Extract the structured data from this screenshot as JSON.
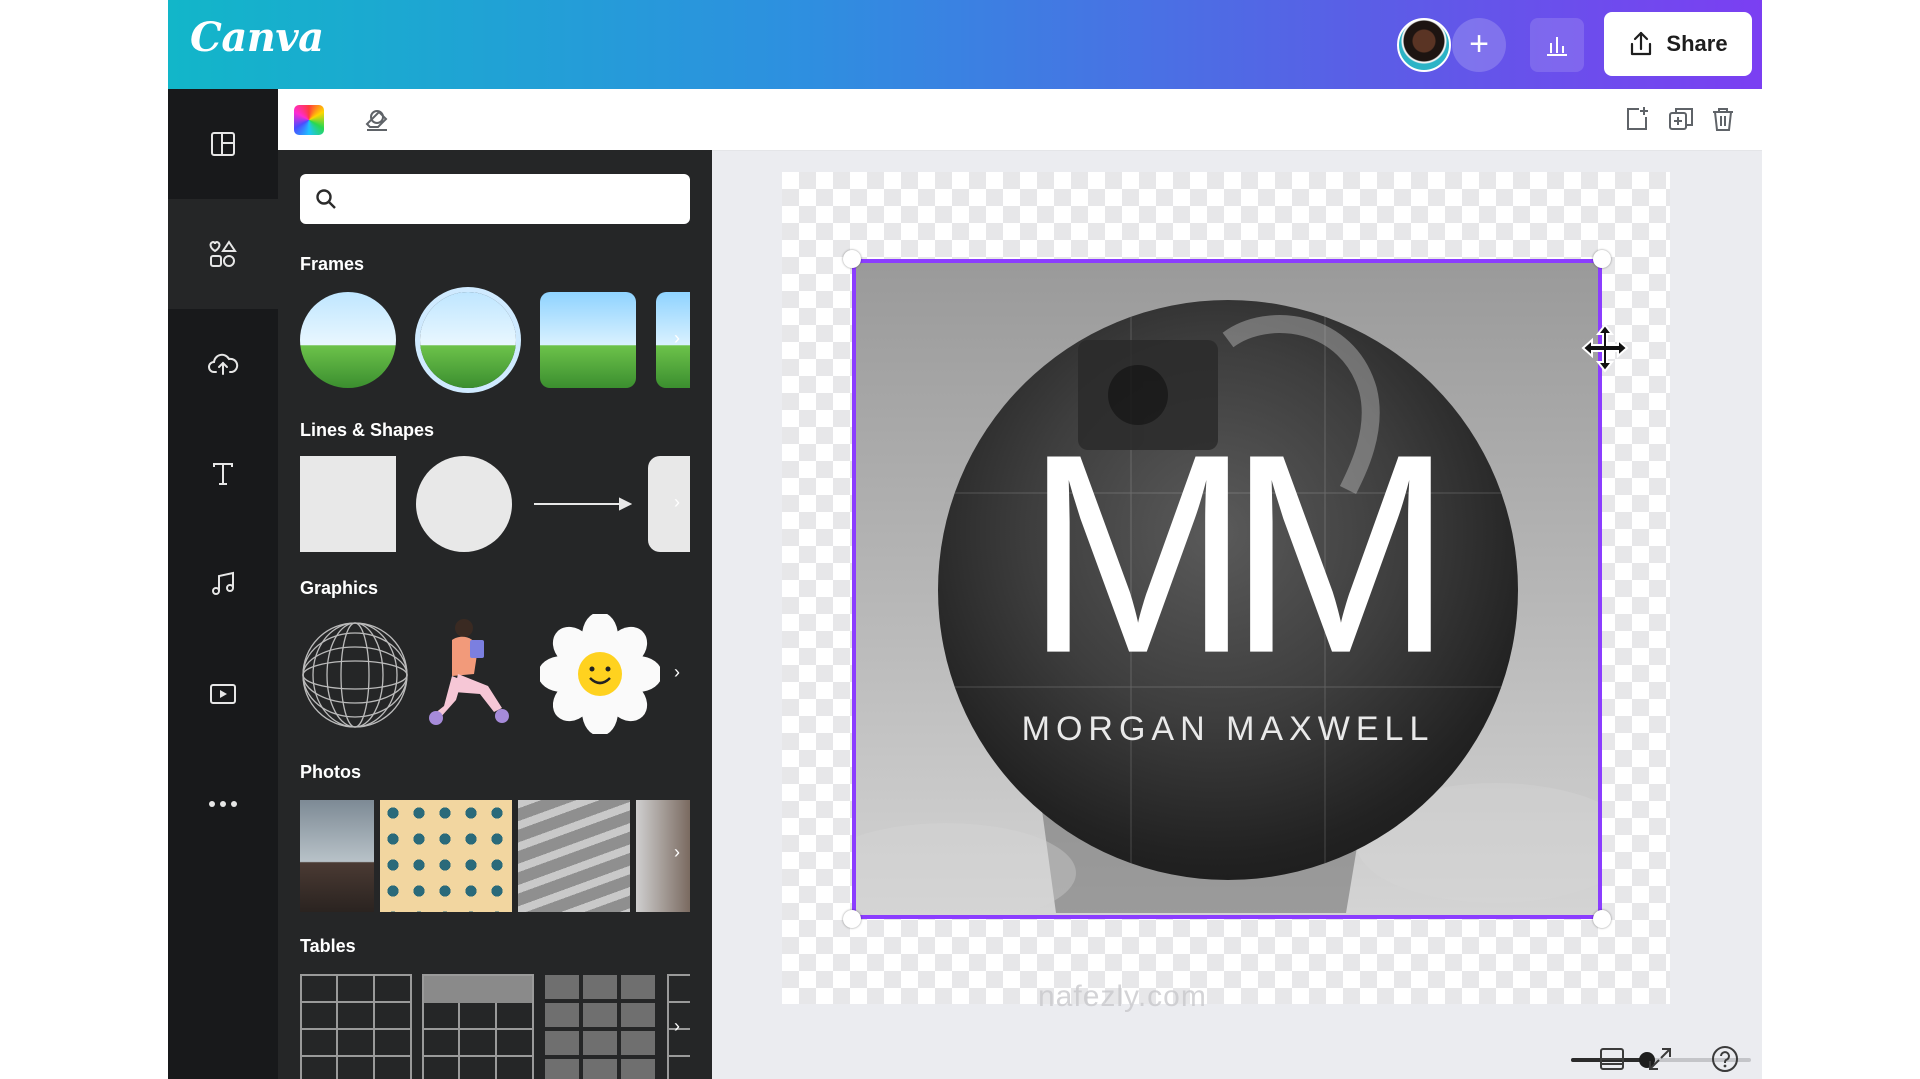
{
  "header": {
    "logo": "Canva",
    "share_label": "Share",
    "add_symbol": "+"
  },
  "sidebar": {
    "items": [
      {
        "icon": "templates-icon"
      },
      {
        "icon": "elements-icon",
        "active": true
      },
      {
        "icon": "uploads-icon"
      },
      {
        "icon": "text-icon"
      },
      {
        "icon": "audio-icon"
      },
      {
        "icon": "video-icon"
      },
      {
        "icon": "more-icon"
      }
    ]
  },
  "panel": {
    "search": {
      "placeholder": "",
      "value": ""
    },
    "sections": {
      "frames": "Frames",
      "shapes": "Lines & Shapes",
      "graphics": "Graphics",
      "photos": "Photos",
      "tables": "Tables"
    },
    "more_symbol": "›"
  },
  "design": {
    "monogram": "MM",
    "name": "MORGAN MAXWELL"
  },
  "watermark": "nafezly.com",
  "zoom": {
    "level": 0.42
  },
  "colors": {
    "accent": "#8b3dff",
    "sidebar": "#18191b",
    "panel": "#252627"
  }
}
